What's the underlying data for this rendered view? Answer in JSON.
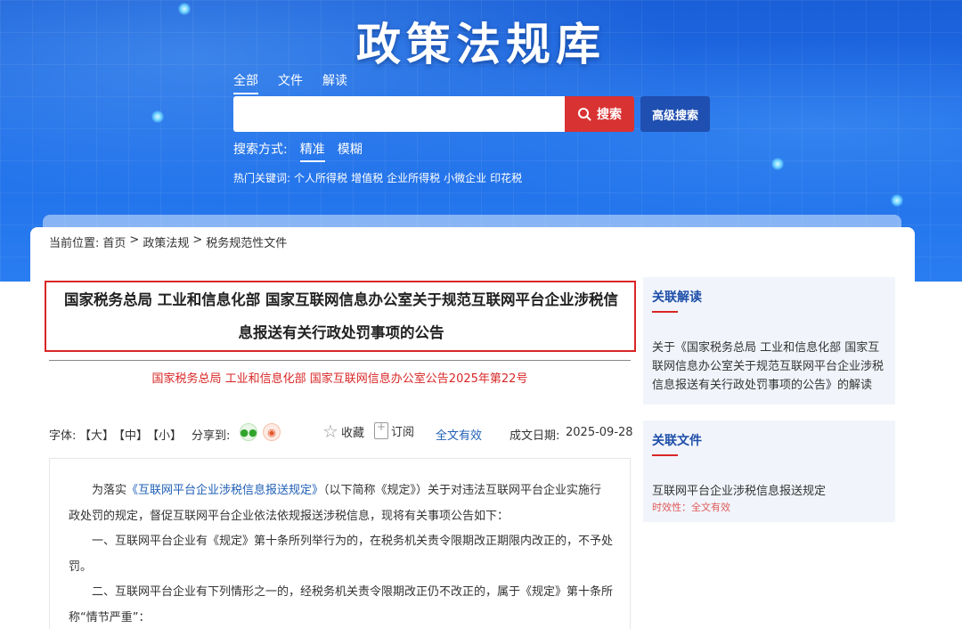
{
  "banner": {
    "title": "政策法规库",
    "tabs": [
      "全部",
      "文件",
      "解读"
    ],
    "search_button": "搜索",
    "advanced_button": "高级搜索",
    "search_mode_label": "搜索方式:",
    "search_modes": [
      "精准",
      "模糊"
    ],
    "hot_label": "热门关键词:",
    "hot_keywords": [
      "个人所得税",
      "增值税",
      "企业所得税",
      "小微企业",
      "印花税"
    ]
  },
  "breadcrumb": {
    "label": "当前位置:",
    "items": [
      "首页",
      "政策法规",
      "税务规范性文件"
    ],
    "separator": ">"
  },
  "document": {
    "title_line1": "国家税务总局 工业和信息化部 国家互联网信息办公室关于规范互联网平台企业涉税信",
    "title_line2": "息报送有关行政处罚事项的公告",
    "doc_number": "国家税务总局 工业和信息化部 国家互联网信息办公室公告2025年第22号",
    "toolbar": {
      "font_label": "字体:",
      "font_large": "【大】",
      "font_medium": "【中】",
      "font_small": "【小】",
      "share_label": "分享到:",
      "favorite": "收藏",
      "subscribe": "订阅",
      "validity": "全文有效",
      "date_label": "成文日期:",
      "date": "2025-09-28"
    },
    "paragraphs": {
      "p1_prefix": "为落实",
      "p1_link": "《互联网平台企业涉税信息报送规定》",
      "p1_line1_rest": "（以下简称《规定》）关于对违法互联网平台企业实施行",
      "p1_line2": "政处罚的规定，督促互联网平台企业依法依规报送涉税信息，现将有关事项公告如下：",
      "p2_line1": "一、互联网平台企业有《规定》第十条所列举行为的，在税务机关责令限期改正期限内改正的，不予处",
      "p2_line2": "罚。",
      "p3_line1": "二、互联网平台企业有下列情形之一的，经税务机关责令限期改正仍不改正的，属于《规定》第十条所",
      "p3_line2": "称“情节严重”："
    }
  },
  "sidebar": {
    "related_reading": {
      "heading": "关联解读",
      "line1": "关于《国家税务总局 工业和信息化部 国家互",
      "line2": "联网信息办公室关于规范互联网平台企业涉税",
      "line3": "信息报送有关行政处罚事项的公告》的解读"
    },
    "related_files": {
      "heading": "关联文件",
      "title": "互联网平台企业涉税信息报送规定",
      "status": "时效性：全文有效"
    }
  },
  "colors": {
    "accent_red": "#d93232",
    "link_blue": "#1f5fb6",
    "heading_blue": "#1d4ea8",
    "banner_blue": "#1f6ee8"
  }
}
